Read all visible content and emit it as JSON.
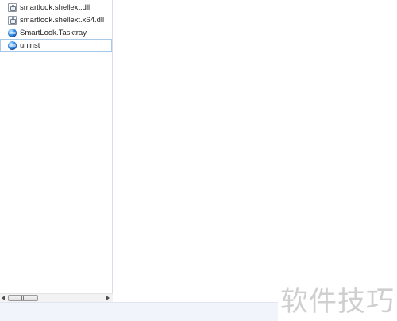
{
  "navigation_pane": {
    "files": [
      {
        "name": "smartlook.shellext.dll",
        "icon": "dll-file-icon",
        "selected": false
      },
      {
        "name": "smartlook.shellext.x64.dll",
        "icon": "dll-file-icon",
        "selected": false
      },
      {
        "name": "SmartLook.Tasktray",
        "icon": "application-icon",
        "selected": false
      },
      {
        "name": "uninst",
        "icon": "application-icon",
        "selected": true
      }
    ]
  },
  "scrollbar": {
    "position": 0.0
  },
  "watermark": {
    "text": "软件技巧"
  }
}
